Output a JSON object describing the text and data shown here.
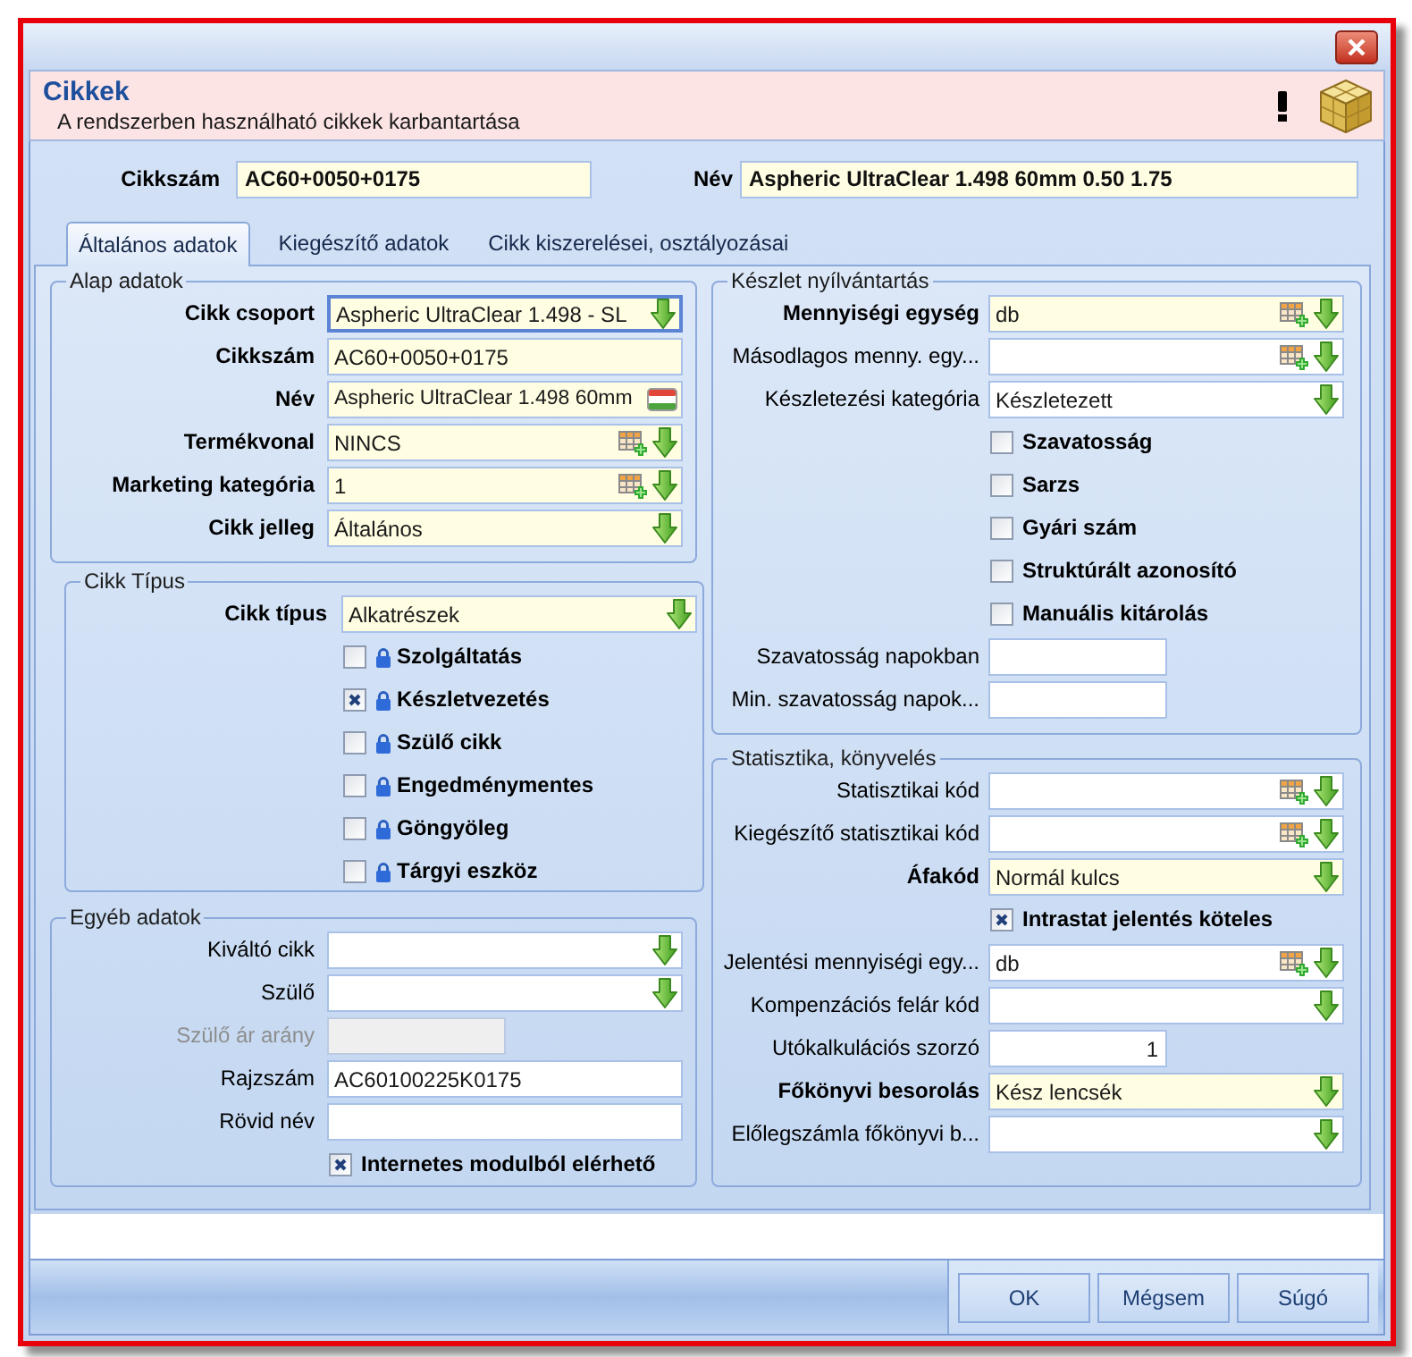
{
  "header": {
    "title": "Cikkek",
    "subtitle": "A rendszerben használható cikkek karbantartása"
  },
  "top_fields": [
    {
      "label": "Cikkszám",
      "value": "AC60+0050+0175"
    },
    {
      "label": "Név",
      "value": "Aspheric UltraClear 1.498 60mm 0.50 1.75"
    }
  ],
  "tabs": [
    {
      "label": "Általános adatok",
      "selected": true
    },
    {
      "label": "Kiegészítő adatok",
      "selected": false
    },
    {
      "label": "Cikk kiszerelései, osztályozásai",
      "selected": false
    }
  ],
  "left_groups": [
    {
      "title": "Alap adatok",
      "items": [
        {
          "kind": "dropdown",
          "label": "Cikk csoport",
          "value": "Aspheric UltraClear 1.498 - SL",
          "required": true,
          "focused": true,
          "disabled": false
        },
        {
          "kind": "text",
          "label": "Cikkszám",
          "value": "AC60+0050+0175",
          "required": true,
          "focused": false,
          "disabled": false
        },
        {
          "kind": "translatable",
          "label": "Név",
          "value": "Aspheric UltraClear 1.498 60mm",
          "required": true,
          "focused": false,
          "disabled": false
        },
        {
          "kind": "lookup",
          "label": "Termékvonal",
          "value": "NINCS",
          "required": true,
          "focused": false,
          "disabled": false
        },
        {
          "kind": "lookup",
          "label": "Marketing kategória",
          "value": "1",
          "required": true,
          "focused": false,
          "disabled": false
        },
        {
          "kind": "dropdown",
          "label": "Cikk jelleg",
          "value": "Általános",
          "required": true,
          "focused": false,
          "disabled": false
        }
      ]
    },
    {
      "title": "Cikk Típus",
      "items": [
        {
          "kind": "dropdown",
          "label": "Cikk típus",
          "value": "Alkatrészek",
          "required": true,
          "focused": false,
          "disabled": false
        },
        {
          "kind": "checkbox",
          "label": "Szolgáltatás",
          "checked": false,
          "locked": true
        },
        {
          "kind": "checkbox",
          "label": "Készletvezetés",
          "checked": true,
          "locked": true
        },
        {
          "kind": "checkbox",
          "label": "Szülő cikk",
          "checked": false,
          "locked": true
        },
        {
          "kind": "checkbox",
          "label": "Engedménymentes",
          "checked": false,
          "locked": true
        },
        {
          "kind": "checkbox",
          "label": "Göngyöleg",
          "checked": false,
          "locked": true
        },
        {
          "kind": "checkbox",
          "label": "Tárgyi eszköz",
          "checked": false,
          "locked": true
        }
      ]
    },
    {
      "title": "Egyéb adatok",
      "items": [
        {
          "kind": "dropdown",
          "label": "Kiváltó cikk",
          "required": false,
          "focused": false,
          "disabled": false
        },
        {
          "kind": "dropdown",
          "label": "Szülő",
          "required": false,
          "focused": false,
          "disabled": false
        },
        {
          "kind": "short",
          "label": "Szülő ár arány",
          "required": false,
          "focused": false,
          "disabled": true
        },
        {
          "kind": "text",
          "label": "Rajzszám",
          "value": "AC60100225K0175",
          "required": false,
          "focused": false,
          "disabled": false
        },
        {
          "kind": "text",
          "label": "Rövid név",
          "required": false,
          "focused": false,
          "disabled": false
        },
        {
          "kind": "checkbox",
          "label": "Internetes modulból elérhető",
          "checked": true,
          "locked": false
        }
      ]
    }
  ],
  "right_groups": [
    {
      "title": "Készlet nyílvántartás",
      "items": [
        {
          "kind": "lookup",
          "label": "Mennyiségi egység",
          "value": "db",
          "required": true,
          "focused": false,
          "disabled": false
        },
        {
          "kind": "lookup",
          "label": "Másodlagos menny. egy...",
          "required": false,
          "focused": false,
          "disabled": false
        },
        {
          "kind": "dropdown",
          "label": "Készletezési kategória",
          "value": "Készletezett",
          "required": false,
          "focused": false,
          "disabled": false
        },
        {
          "kind": "checkbox",
          "label": "Szavatosság",
          "checked": false,
          "locked": false
        },
        {
          "kind": "checkbox",
          "label": "Sarzs",
          "checked": false,
          "locked": false
        },
        {
          "kind": "checkbox",
          "label": "Gyári szám",
          "checked": false,
          "locked": false
        },
        {
          "kind": "checkbox",
          "label": "Struktúrált azonosító",
          "checked": false,
          "locked": false
        },
        {
          "kind": "checkbox",
          "label": "Manuális kitárolás",
          "checked": false,
          "locked": false
        },
        {
          "kind": "short",
          "label": "Szavatosság napokban",
          "required": false,
          "focused": false,
          "disabled": false
        },
        {
          "kind": "short",
          "label": "Min. szavatosság napok...",
          "required": false,
          "focused": false,
          "disabled": false
        }
      ]
    },
    {
      "title": "Statisztika, könyvelés",
      "items": [
        {
          "kind": "lookup",
          "label": "Statisztikai kód",
          "required": false,
          "focused": false,
          "disabled": false
        },
        {
          "kind": "lookup",
          "label": "Kiegészítő statisztikai kód",
          "required": false,
          "focused": false,
          "disabled": false
        },
        {
          "kind": "dropdown",
          "label": "Áfakód",
          "value": "Normál kulcs",
          "required": true,
          "focused": false,
          "disabled": false
        },
        {
          "kind": "checkbox",
          "label": "Intrastat jelentés köteles",
          "checked": true,
          "locked": false
        },
        {
          "kind": "lookup",
          "label": "Jelentési mennyiségi egy...",
          "value": "db",
          "required": false,
          "focused": false,
          "disabled": false
        },
        {
          "kind": "dropdown",
          "label": "Kompenzációs felár kód",
          "required": false,
          "focused": false,
          "disabled": false
        },
        {
          "kind": "number",
          "label": "Utókalkulációs szorzó",
          "value": "1",
          "required": false,
          "focused": false,
          "disabled": false
        },
        {
          "kind": "dropdown",
          "label": "Főkönyvi besorolás",
          "value": "Kész lencsék",
          "required": true,
          "focused": false,
          "disabled": false
        },
        {
          "kind": "dropdown",
          "label": "Előlegszámla főkönyvi b...",
          "required": false,
          "focused": false,
          "disabled": false
        }
      ]
    }
  ],
  "buttons": [
    "OK",
    "Mégsem",
    "Súgó"
  ]
}
